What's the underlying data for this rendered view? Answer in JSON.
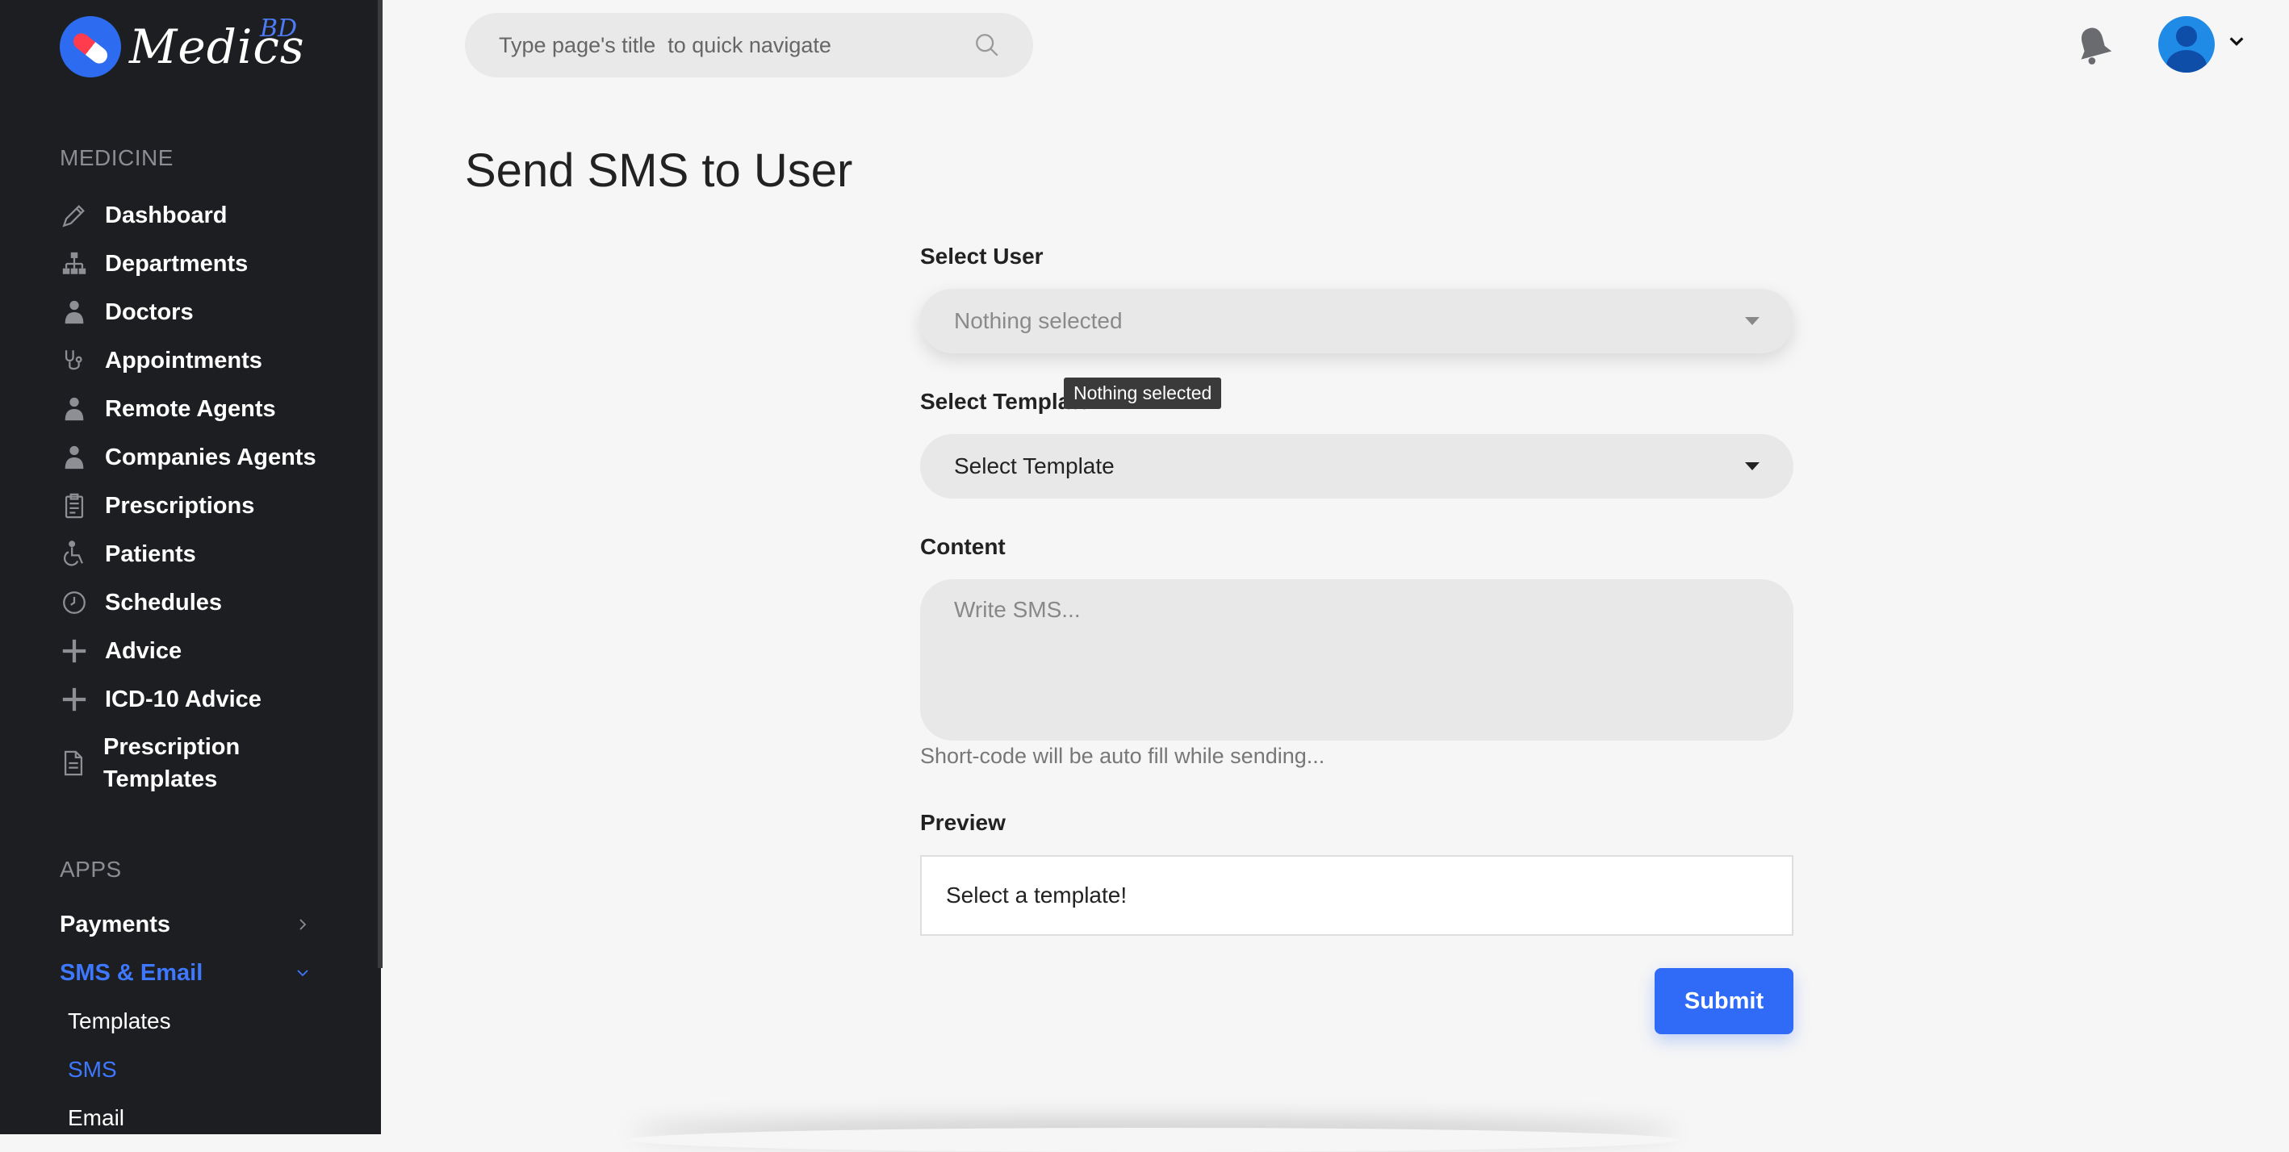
{
  "brand": {
    "name": "Medics",
    "suffix": "BD"
  },
  "sidebar": {
    "section_medicine": "MEDICINE",
    "items": [
      {
        "label": "Dashboard",
        "icon": "pen-icon"
      },
      {
        "label": "Departments",
        "icon": "sitemap-icon"
      },
      {
        "label": "Doctors",
        "icon": "doctor-icon"
      },
      {
        "label": "Appointments",
        "icon": "stethoscope-icon"
      },
      {
        "label": "Remote Agents",
        "icon": "agent-icon"
      },
      {
        "label": "Companies Agents",
        "icon": "agent-icon"
      },
      {
        "label": "Prescriptions",
        "icon": "clipboard-icon"
      },
      {
        "label": "Patients",
        "icon": "wheelchair-icon"
      },
      {
        "label": "Schedules",
        "icon": "clock-icon"
      },
      {
        "label": "Advice",
        "icon": "plus-icon"
      },
      {
        "label": "ICD-10 Advice",
        "icon": "plus-icon"
      },
      {
        "label": "Prescription Templates",
        "icon": "document-icon"
      }
    ],
    "section_apps": "APPS",
    "apps": [
      {
        "label": "Payments",
        "icon": "chevron-right-icon"
      },
      {
        "label": "SMS & Email",
        "icon": "chevron-down-icon"
      }
    ],
    "sub_items": [
      "Templates",
      "SMS",
      "Email"
    ]
  },
  "topbar": {
    "search_placeholder": "Type page's title  to quick navigate"
  },
  "main": {
    "title": "Send SMS to User",
    "select_user": {
      "label": "Select User",
      "value": "Nothing selected"
    },
    "tooltip": "Nothing selected",
    "select_template": {
      "label": "Select Template",
      "value": "Select Template"
    },
    "content": {
      "label": "Content",
      "placeholder": "Write SMS...",
      "help": "Short-code will be auto fill while sending..."
    },
    "preview": {
      "label": "Preview",
      "value": "Select a template!"
    },
    "submit_label": "Submit"
  },
  "colors": {
    "accent": "#2f6bf7",
    "sidebar_bg": "#1d1e21",
    "field_bg": "#e8e8e8"
  }
}
